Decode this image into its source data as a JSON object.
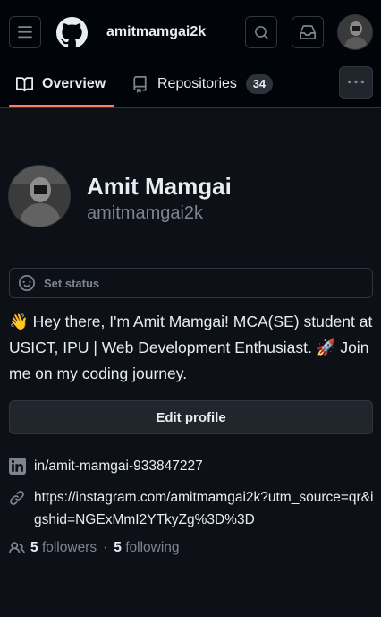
{
  "header": {
    "username": "amitmamgai2k",
    "menu_icon": "hamburger-icon",
    "logo_icon": "github-logo",
    "search_icon": "search-icon",
    "inbox_icon": "inbox-icon"
  },
  "tabs": [
    {
      "label": "Overview",
      "icon": "book-icon",
      "selected": true
    },
    {
      "label": "Repositories",
      "icon": "repo-icon",
      "count": "34"
    }
  ],
  "more_icon": "kebab-horizontal-icon",
  "profile": {
    "name": "Amit Mamgai",
    "login": "amitmamgai2k",
    "status_placeholder": "Set status",
    "bio": "👋 Hey there, I'm Amit Mamgai! MCA(SE) student at USICT, IPU | Web Development Enthusiast. 🚀 Join me on my coding journey.",
    "edit_button": "Edit profile",
    "linkedin": "in/amit-mamgai-933847227",
    "website": "https://instagram.com/amitmamgai2k?utm_source=qr&igshid=NGExMmI2YTkyZg%3D%3D",
    "followers_count": "5",
    "followers_label": "followers",
    "following_count": "5",
    "following_label": "following",
    "separator": "·"
  },
  "colors": {
    "background": "#0d1117",
    "header_bg": "#010409",
    "border": "#30363d",
    "accent_underline": "#f78166",
    "muted_text": "#7d8590"
  }
}
